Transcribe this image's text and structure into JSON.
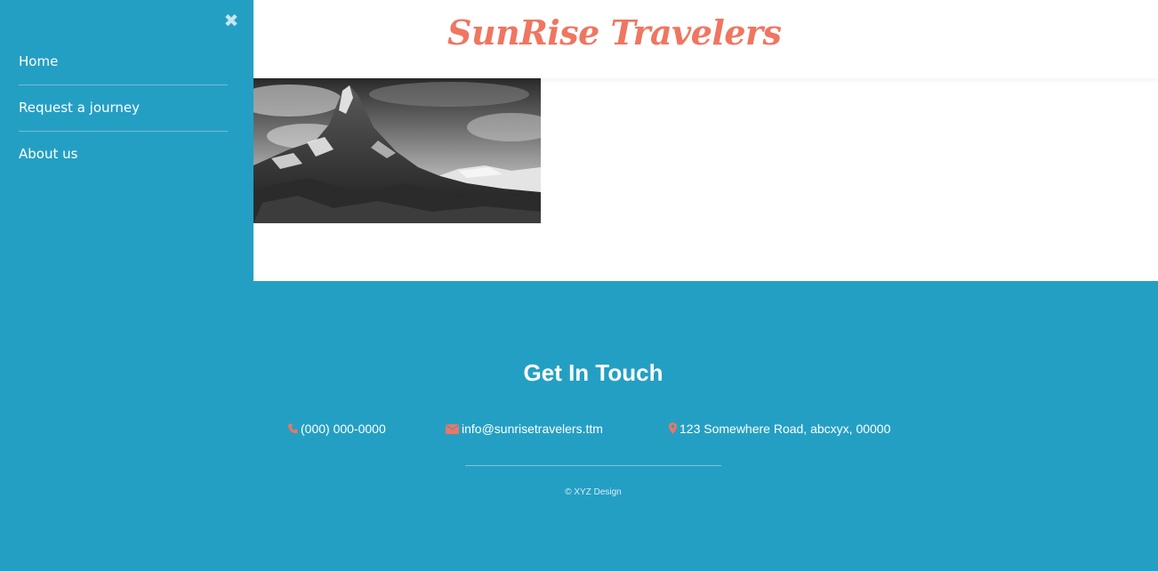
{
  "sidebar": {
    "close_glyph": "✖",
    "items": [
      {
        "label": "Home"
      },
      {
        "label": "Request a journey"
      },
      {
        "label": "About us"
      }
    ]
  },
  "header": {
    "brand": "SunRise Travelers"
  },
  "footer": {
    "title": "Get In Touch",
    "phone": "(000) 000-0000",
    "email": "info@sunrisetravelers.ttm",
    "address": "123 Somewhere Road, abcxyx, 00000",
    "copyright": "© XYZ Design"
  },
  "colors": {
    "primary": "#249fc4",
    "accent": "#ef7661",
    "surface": "#ffffff"
  },
  "icons": {
    "phone": "phone-icon",
    "email": "envelope-icon",
    "address": "map-marker-icon",
    "close": "close-icon"
  }
}
